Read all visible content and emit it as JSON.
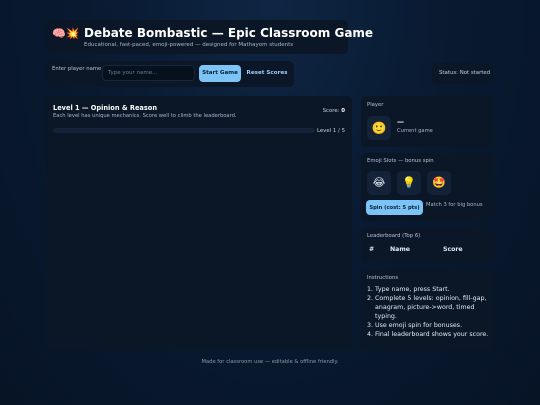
{
  "header": {
    "emoji": "🧠💥",
    "title": "Debate Bombastic — Epic Classroom Game",
    "subtitle": "Educational, fast-paced, emoji-powered — designed for Mathayom students"
  },
  "controls": {
    "name_label": "Enter player name",
    "name_value": "",
    "name_placeholder": "Type your name...",
    "start_label": "Start Game",
    "reset_label": "Reset Scores"
  },
  "status": {
    "text": "Status: Not started"
  },
  "game": {
    "level_title": "Level 1 — Opinion & Reason",
    "level_desc": "Each level has unique mechanics. Score well to climb the leaderboard.",
    "score_label": "Score:",
    "score_value": "0",
    "progress_fraction": 0,
    "level_counter": "Level 1 / 5"
  },
  "player": {
    "heading": "Player",
    "avatar": "🙂",
    "name": "—",
    "meta": "Current game"
  },
  "slots": {
    "heading": "Emoji Slots — bonus spin",
    "reels": [
      "😂",
      "💡",
      "🤩"
    ],
    "spin_label": "Spin (cost: 5 pts)",
    "tip": "Match 3 for big bonus"
  },
  "leaderboard": {
    "heading": "Leaderboard (Top 6)",
    "columns": [
      "#",
      "Name",
      "Score"
    ]
  },
  "instructions": {
    "heading": "Instructions",
    "items": [
      "1. Type name, press Start.",
      "2. Complete 5 levels: opinion, fill-gap, anagram, picture->word, timed typing.",
      "3. Use emoji spin for bonuses.",
      "4. Final leaderboard shows your score."
    ]
  },
  "footer": {
    "text": "Made for classroom use — editable & offline friendly."
  },
  "colors": {
    "accent": "#7cc3f6",
    "panel": "#0b1727",
    "background": "#071426"
  }
}
